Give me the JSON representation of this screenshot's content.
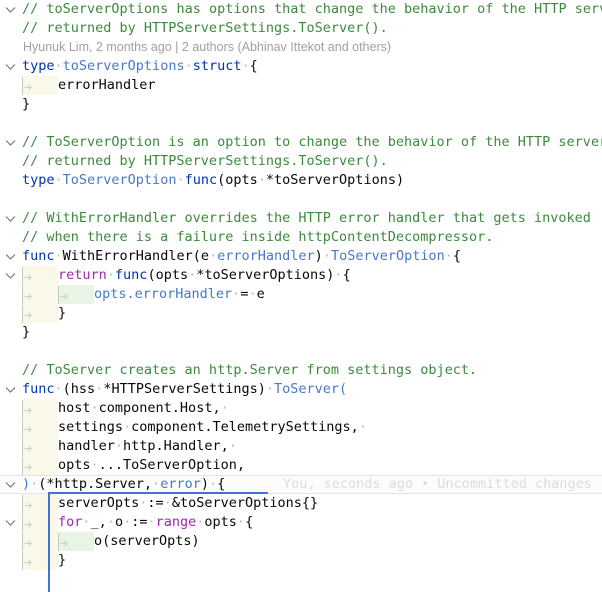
{
  "editor": {
    "language": "Go",
    "theme": "IntelliJ Light",
    "colors": {
      "background": "#ffffff",
      "keyword": "#0033b3",
      "control_keyword": "#9d28b0",
      "type_name": "#4a78c8",
      "comment": "#3c8a3c",
      "plain_text": "#080808",
      "whitespace_dot": "#b8b8b8",
      "indent_band_level1": "#faf8e8",
      "indent_band_level2": "#e9f5e4",
      "scope_bracket": "#4272d8",
      "caret_line": "#fcfcfc",
      "blame_text": "#a0a0a0",
      "inline_blame_text": "#dcdcdc"
    }
  },
  "blame": {
    "top_annotation": "Hyunuk Lim, 2 months ago | 2 authors (Abhinav Ittekot and others)",
    "inline_annotation": "You, seconds ago • Uncommitted changes"
  },
  "lines": [
    {
      "n": 1,
      "fold": "collapse",
      "indent": 0,
      "text": "// toServerOptions has options that change the behavior of the HTTP server",
      "tokens": [
        {
          "t": "// ",
          "c": "cmt"
        },
        {
          "t": "toServerOptions",
          "c": "cmt"
        },
        {
          "t": " has options that change the behavior of the HTTP server",
          "c": "cmt"
        }
      ]
    },
    {
      "n": 2,
      "fold": "none",
      "indent": 0,
      "text": "// returned by HTTPServerSettings.ToServer().",
      "tokens": [
        {
          "t": "// returned by HTTPServerSettings.ToServer().",
          "c": "cmt"
        }
      ]
    },
    {
      "n": 3,
      "fold": "none",
      "indent": 0,
      "text": "",
      "is_blame_row": true
    },
    {
      "n": 4,
      "fold": "collapse",
      "indent": 0,
      "text": "type toServerOptions struct {",
      "tokens": [
        {
          "t": "type",
          "c": "kw"
        },
        {
          "t": " ",
          "c": "dot"
        },
        {
          "t": "toServerOptions",
          "c": "typ"
        },
        {
          "t": " ",
          "c": "dot"
        },
        {
          "t": "struct",
          "c": "kw"
        },
        {
          "t": " ",
          "c": "dot"
        },
        {
          "t": "{",
          "c": "pl"
        }
      ]
    },
    {
      "n": 5,
      "fold": "none",
      "indent": 1,
      "text": "    errorHandler",
      "tokens": [
        {
          "t": "errorHandler",
          "c": "pl"
        }
      ]
    },
    {
      "n": 6,
      "fold": "none",
      "indent": 0,
      "text": "}",
      "tokens": [
        {
          "t": "}",
          "c": "pl"
        }
      ]
    },
    {
      "n": 7,
      "fold": "none",
      "indent": 0,
      "text": "",
      "tokens": []
    },
    {
      "n": 8,
      "fold": "collapse",
      "indent": 0,
      "text": "// ToServerOption is an option to change the behavior of the HTTP server",
      "tokens": [
        {
          "t": "// ToServerOption is an option to change the behavior of the HTTP server",
          "c": "cmt"
        }
      ]
    },
    {
      "n": 9,
      "fold": "none",
      "indent": 0,
      "text": "// returned by HTTPServerSettings.ToServer().",
      "tokens": [
        {
          "t": "// returned by HTTPServerSettings.ToServer().",
          "c": "cmt"
        }
      ]
    },
    {
      "n": 10,
      "fold": "none",
      "indent": 0,
      "text": "type ToServerOption func(opts *toServerOptions)",
      "tokens": [
        {
          "t": "type",
          "c": "kw"
        },
        {
          "t": " ",
          "c": "dot"
        },
        {
          "t": "ToServerOption",
          "c": "typ"
        },
        {
          "t": " ",
          "c": "dot"
        },
        {
          "t": "func",
          "c": "kw"
        },
        {
          "t": "(",
          "c": "pl"
        },
        {
          "t": "opts",
          "c": "pl"
        },
        {
          "t": " ",
          "c": "dot"
        },
        {
          "t": "*toServerOptions",
          "c": "pl"
        },
        {
          "t": ")",
          "c": "pl"
        }
      ]
    },
    {
      "n": 11,
      "fold": "none",
      "indent": 0,
      "text": "",
      "tokens": []
    },
    {
      "n": 12,
      "fold": "collapse",
      "indent": 0,
      "text": "// WithErrorHandler overrides the HTTP error handler that gets invoked",
      "tokens": [
        {
          "t": "// WithErrorHandler overrides the HTTP error handler that gets invoked",
          "c": "cmt"
        }
      ]
    },
    {
      "n": 13,
      "fold": "none",
      "indent": 0,
      "text": "// when there is a failure inside httpContentDecompressor.",
      "tokens": [
        {
          "t": "// when there is a failure inside httpContentDecompressor.",
          "c": "cmt"
        }
      ]
    },
    {
      "n": 14,
      "fold": "collapse",
      "indent": 0,
      "text": "func WithErrorHandler(e errorHandler) ToServerOption {",
      "tokens": [
        {
          "t": "func",
          "c": "kw"
        },
        {
          "t": " ",
          "c": "dot"
        },
        {
          "t": "WithErrorHandler",
          "c": "pl"
        },
        {
          "t": "(",
          "c": "pl"
        },
        {
          "t": "e",
          "c": "pl"
        },
        {
          "t": " ",
          "c": "dot"
        },
        {
          "t": "errorHandler",
          "c": "typ"
        },
        {
          "t": ")",
          "c": "pl"
        },
        {
          "t": " ",
          "c": "dot"
        },
        {
          "t": "ToServerOption",
          "c": "typ"
        },
        {
          "t": " ",
          "c": "dot"
        },
        {
          "t": "{",
          "c": "pl"
        }
      ]
    },
    {
      "n": 15,
      "fold": "collapse",
      "indent": 1,
      "text": "    return func(opts *toServerOptions) {",
      "tokens": [
        {
          "t": "return",
          "c": "kw2"
        },
        {
          "t": " ",
          "c": "dot"
        },
        {
          "t": "func",
          "c": "kw"
        },
        {
          "t": "(",
          "c": "pl"
        },
        {
          "t": "opts",
          "c": "pl"
        },
        {
          "t": " ",
          "c": "dot"
        },
        {
          "t": "*toServerOptions",
          "c": "pl"
        },
        {
          "t": ")",
          "c": "pl"
        },
        {
          "t": " ",
          "c": "dot"
        },
        {
          "t": "{",
          "c": "pl"
        }
      ]
    },
    {
      "n": 16,
      "fold": "none",
      "indent": 2,
      "text": "        opts.errorHandler = e",
      "tokens": [
        {
          "t": "opts.errorHandler",
          "c": "typ"
        },
        {
          "t": " ",
          "c": "dot"
        },
        {
          "t": "=",
          "c": "pl"
        },
        {
          "t": " ",
          "c": "dot"
        },
        {
          "t": "e",
          "c": "pl"
        }
      ]
    },
    {
      "n": 17,
      "fold": "none",
      "indent": 1,
      "text": "    }",
      "tokens": [
        {
          "t": "}",
          "c": "pl"
        }
      ]
    },
    {
      "n": 18,
      "fold": "none",
      "indent": 0,
      "text": "}",
      "tokens": [
        {
          "t": "}",
          "c": "pl"
        }
      ]
    },
    {
      "n": 19,
      "fold": "none",
      "indent": 0,
      "text": "",
      "tokens": []
    },
    {
      "n": 20,
      "fold": "none",
      "indent": 0,
      "text": "// ToServer creates an http.Server from settings object.",
      "tokens": [
        {
          "t": "// ToServer creates an http.Server from settings object.",
          "c": "cmt"
        }
      ]
    },
    {
      "n": 21,
      "fold": "collapse",
      "indent": 0,
      "text": "func (hss *HTTPServerSettings) ToServer(",
      "tokens": [
        {
          "t": "func",
          "c": "kw"
        },
        {
          "t": " ",
          "c": "dot"
        },
        {
          "t": "(hss",
          "c": "pl"
        },
        {
          "t": " ",
          "c": "dot"
        },
        {
          "t": "*HTTPServerSettings)",
          "c": "pl"
        },
        {
          "t": " ",
          "c": "dot"
        },
        {
          "t": "ToServer(",
          "c": "typ"
        }
      ]
    },
    {
      "n": 22,
      "fold": "none",
      "indent": 1,
      "text": "    host component.Host,",
      "tokens": [
        {
          "t": "host",
          "c": "pl"
        },
        {
          "t": " ",
          "c": "dot"
        },
        {
          "t": "component.Host,",
          "c": "pl"
        },
        {
          "t": " ",
          "c": "dot"
        }
      ]
    },
    {
      "n": 23,
      "fold": "none",
      "indent": 1,
      "text": "    settings component.TelemetrySettings,",
      "tokens": [
        {
          "t": "settings",
          "c": "pl"
        },
        {
          "t": " ",
          "c": "dot"
        },
        {
          "t": "component.TelemetrySettings,",
          "c": "pl"
        },
        {
          "t": " ",
          "c": "dot"
        }
      ]
    },
    {
      "n": 24,
      "fold": "none",
      "indent": 1,
      "text": "    handler http.Handler,",
      "tokens": [
        {
          "t": "handler",
          "c": "pl"
        },
        {
          "t": " ",
          "c": "dot"
        },
        {
          "t": "http.Handler,",
          "c": "pl"
        },
        {
          "t": " ",
          "c": "dot"
        }
      ]
    },
    {
      "n": 25,
      "fold": "none",
      "indent": 1,
      "text": "    opts ...ToServerOption,",
      "tokens": [
        {
          "t": "opts",
          "c": "pl"
        },
        {
          "t": " ",
          "c": "dot"
        },
        {
          "t": "...ToServerOption,",
          "c": "pl"
        }
      ]
    },
    {
      "n": 26,
      "fold": "collapse",
      "indent": 0,
      "is_caret_line": true,
      "text": ") (*http.Server, error) {",
      "tokens": [
        {
          "t": ")",
          "c": "typ"
        },
        {
          "t": " ",
          "c": "dot"
        },
        {
          "t": "(*http.Server,",
          "c": "pl"
        },
        {
          "t": " ",
          "c": "dot"
        },
        {
          "t": "error",
          "c": "typ"
        },
        {
          "t": ")",
          "c": "pl"
        },
        {
          "t": " ",
          "c": "dot"
        },
        {
          "t": "{",
          "c": "pl"
        }
      ]
    },
    {
      "n": 27,
      "fold": "none",
      "indent": 1,
      "text": "    serverOpts := &toServerOptions{}",
      "tokens": [
        {
          "t": "serverOpts",
          "c": "pl"
        },
        {
          "t": " ",
          "c": "dot"
        },
        {
          "t": ":=",
          "c": "pl"
        },
        {
          "t": " ",
          "c": "dot"
        },
        {
          "t": "&toServerOptions{}",
          "c": "pl"
        }
      ]
    },
    {
      "n": 28,
      "fold": "collapse",
      "indent": 1,
      "text": "    for _, o := range opts {",
      "tokens": [
        {
          "t": "for",
          "c": "kw2"
        },
        {
          "t": " ",
          "c": "dot"
        },
        {
          "t": "_,",
          "c": "pl"
        },
        {
          "t": " ",
          "c": "dot"
        },
        {
          "t": "o",
          "c": "pl"
        },
        {
          "t": " ",
          "c": "dot"
        },
        {
          "t": ":=",
          "c": "pl"
        },
        {
          "t": " ",
          "c": "dot"
        },
        {
          "t": "range",
          "c": "kw2"
        },
        {
          "t": " ",
          "c": "dot"
        },
        {
          "t": "opts",
          "c": "pl"
        },
        {
          "t": " ",
          "c": "dot"
        },
        {
          "t": "{",
          "c": "pl"
        }
      ]
    },
    {
      "n": 29,
      "fold": "none",
      "indent": 2,
      "text": "        o(serverOpts)",
      "tokens": [
        {
          "t": "o(serverOpts)",
          "c": "pl"
        }
      ]
    },
    {
      "n": 30,
      "fold": "none",
      "indent": 1,
      "text": "    }",
      "tokens": [
        {
          "t": "}",
          "c": "pl"
        }
      ]
    }
  ]
}
